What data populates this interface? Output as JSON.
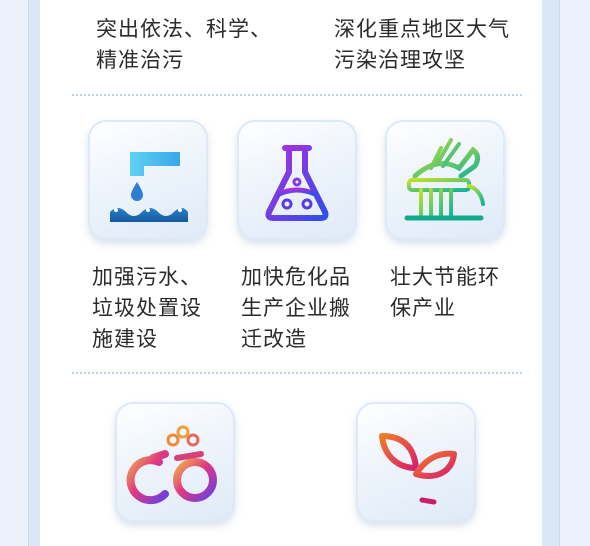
{
  "top_items": [
    {
      "text": "突出依法、科学、\n精准治污"
    },
    {
      "text": "深化重点地区大气\n污染治理攻坚"
    }
  ],
  "tasks": [
    {
      "label": "加强污水、\n垃圾处置设\n施建设",
      "icon": "water-pollution-icon"
    },
    {
      "label": "加快危化品\n生产企业搬\n迁改造",
      "icon": "chemical-flask-icon"
    },
    {
      "label": "壮大节能环\n保产业",
      "icon": "wind-turbine-icon"
    },
    {
      "label": "",
      "icon": "handcuffs-enforcement-icon"
    },
    {
      "label": "",
      "icon": "sprout-icon"
    }
  ]
}
